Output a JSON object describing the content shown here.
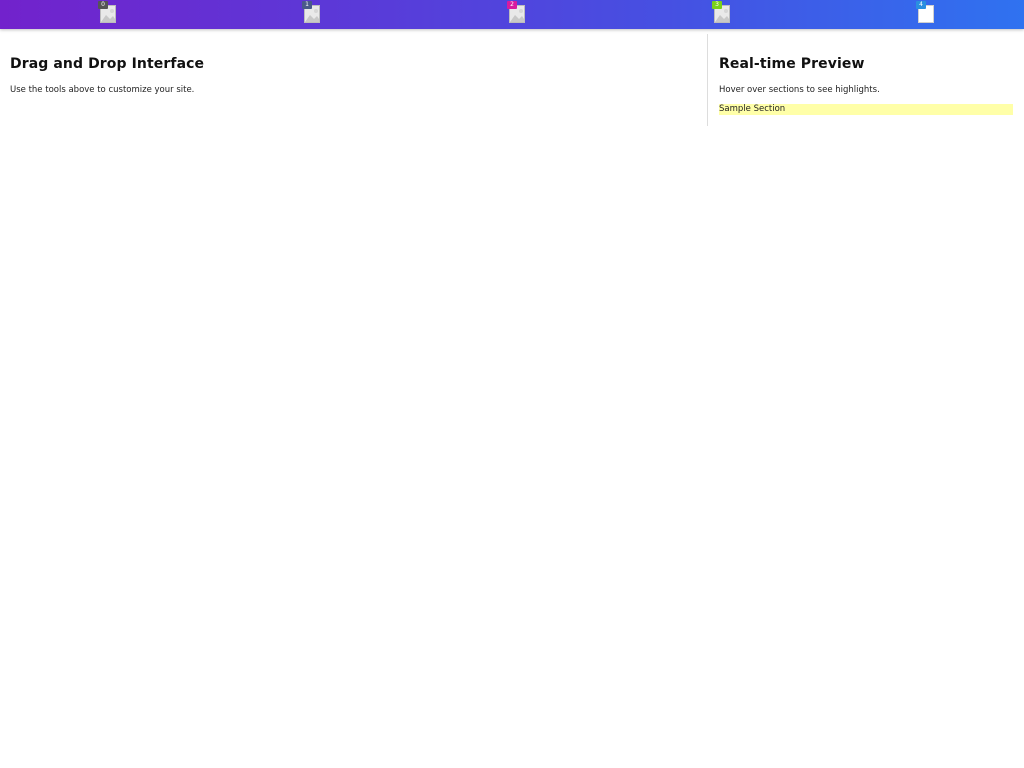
{
  "toolbar": {
    "tools": [
      {
        "badge": "0",
        "badge_color": "#555555",
        "icon": "image-icon"
      },
      {
        "badge": "1",
        "badge_color": "#4a5a8a",
        "icon": "image-icon"
      },
      {
        "badge": "2",
        "badge_color": "#d81ba0",
        "icon": "image-icon"
      },
      {
        "badge": "3",
        "badge_color": "#7ad21a",
        "icon": "image-icon"
      },
      {
        "badge": "4",
        "badge_color": "#2a8fe0",
        "icon": "blank-page-icon"
      }
    ]
  },
  "main": {
    "title": "Drag and Drop Interface",
    "description": "Use the tools above to customize your site."
  },
  "preview": {
    "title": "Real-time Preview",
    "description": "Hover over sections to see highlights.",
    "section_label": "Sample Section",
    "section_highlight_color": "#ffffa8"
  }
}
